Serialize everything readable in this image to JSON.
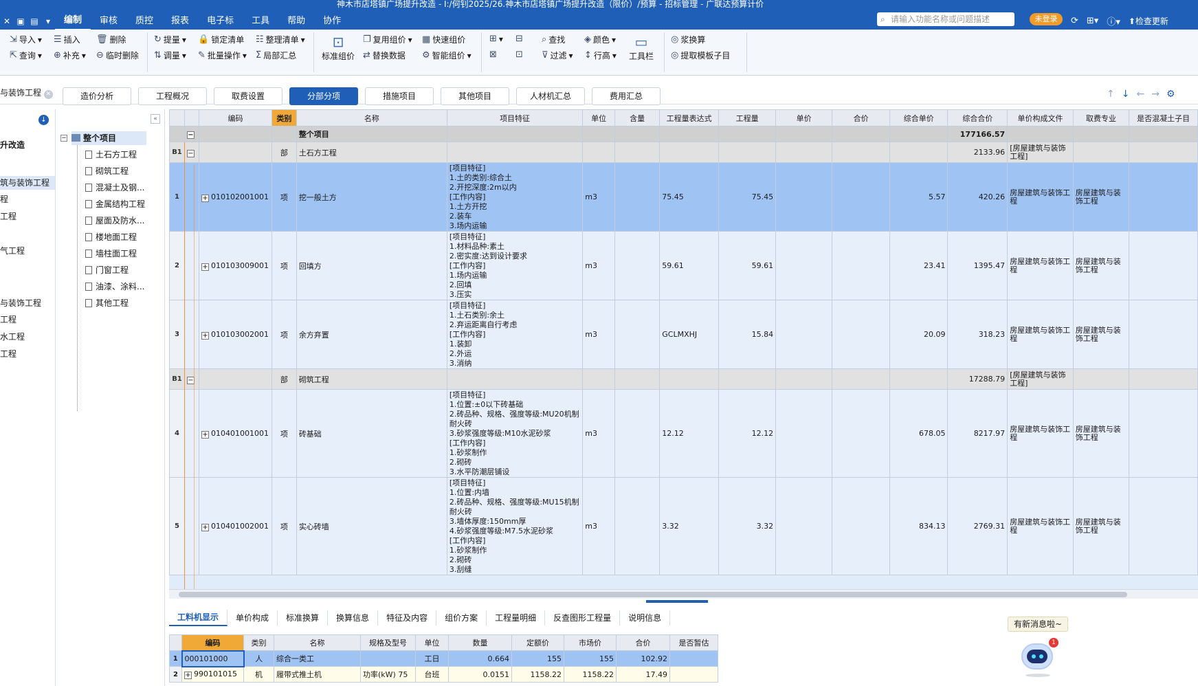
{
  "window": {
    "title": "神木市店塔镇广场提升改造 - I:/何钊2025/26.神木市店塔镇广场提升改造（限价）/预算 - 招标管理 - 广联达预算计价"
  },
  "menu": {
    "items": [
      "编制",
      "审核",
      "质控",
      "报表",
      "电子标",
      "工具",
      "帮助",
      "协作"
    ],
    "search_placeholder": "请输入功能名称或问题描述",
    "login_label": "未登录",
    "check_update": "检查更新"
  },
  "ribbon": {
    "import": "导入",
    "insert": "插入",
    "delete": "删除",
    "query": "查询",
    "supplement": "补充",
    "temp_delete": "临时删除",
    "extract_price": "提量",
    "lock_list": "锁定清单",
    "tidy_list": "整理清单",
    "adjust_qty": "调量",
    "batch_op": "批量操作",
    "partial_summary": "局部汇总",
    "std_price": "标准组价",
    "reuse_price": "复用组价",
    "quick_price": "快速组价",
    "replace_data": "替换数据",
    "smart_price": "智能组价",
    "find": "查找",
    "color": "颜色",
    "filter": "过滤",
    "row_height": "行高",
    "toolbar": "工具栏",
    "paste_calc": "浆换算",
    "extract_template": "提取模板子目"
  },
  "left_pane": {
    "title": "与装饰工程",
    "items": [
      "升改造",
      "筑与装饰工程",
      "程",
      "工程",
      "气工程",
      "与装饰工程",
      "工程",
      "水工程",
      "工程"
    ]
  },
  "tabs": [
    "造价分析",
    "工程概况",
    "取费设置",
    "分部分项",
    "措施项目",
    "其他项目",
    "人材机汇总",
    "费用汇总"
  ],
  "active_tab": "分部分项",
  "tree": {
    "root": "整个项目",
    "children": [
      "土石方工程",
      "砌筑工程",
      "混凝土及钢...",
      "金属结构工程",
      "屋面及防水...",
      "楼地面工程",
      "墙柱面工程",
      "门窗工程",
      "油漆、涂料...",
      "其他工程"
    ]
  },
  "grid": {
    "headers": [
      "编码",
      "类别",
      "名称",
      "项目特征",
      "单位",
      "含量",
      "工程量表达式",
      "工程量",
      "单价",
      "合价",
      "综合单价",
      "综合合价",
      "单价构成文件",
      "取费专业",
      "是否混凝土子目"
    ],
    "total": {
      "name": "整个项目",
      "total_price": "177166.57"
    },
    "rows": [
      {
        "type": "section",
        "rn": "B1",
        "kind": "部",
        "name": "土石方工程",
        "total_price": "2133.96",
        "file": "[房屋建筑与装饰工程]"
      },
      {
        "type": "item",
        "rn": "1",
        "code": "010102001001",
        "kind": "项",
        "name": "挖一般土方",
        "feature": "[项目特征]\n1.土的类别:综合土\n2.开挖深度:2m以内\n[工作内容]\n1.土方开挖\n2.装车\n3.场内运输",
        "unit": "m3",
        "expr": "75.45",
        "qty": "75.45",
        "unit_price": "5.57",
        "total_price": "420.26",
        "file": "房屋建筑与装饰工程",
        "fee": "房屋建筑与装饰工程",
        "selected": true
      },
      {
        "type": "item",
        "rn": "2",
        "code": "010103009001",
        "kind": "项",
        "name": "回填方",
        "feature": "[项目特征]\n1.材料品种:素土\n2.密实度:达到设计要求\n[工作内容]\n1.场内运输\n2.回填\n3.压实",
        "unit": "m3",
        "expr": "59.61",
        "qty": "59.61",
        "unit_price": "23.41",
        "total_price": "1395.47",
        "file": "房屋建筑与装饰工程",
        "fee": "房屋建筑与装饰工程"
      },
      {
        "type": "item",
        "rn": "3",
        "code": "010103002001",
        "kind": "项",
        "name": "余方弃置",
        "feature": "[项目特征]\n1.土石类别:余土\n2.弃运距离自行考虑\n[工作内容]\n1.装卸\n2.外运\n3.消纳",
        "unit": "m3",
        "expr": "GCLMXHJ",
        "qty": "15.84",
        "unit_price": "20.09",
        "total_price": "318.23",
        "file": "房屋建筑与装饰工程",
        "fee": "房屋建筑与装饰工程"
      },
      {
        "type": "section",
        "rn": "B1",
        "kind": "部",
        "name": "砌筑工程",
        "total_price": "17288.79",
        "file": "[房屋建筑与装饰工程]"
      },
      {
        "type": "item",
        "rn": "4",
        "code": "010401001001",
        "kind": "项",
        "name": "砖基础",
        "feature": "[项目特征]\n1.位置:±0以下砖基础\n2.砖品种、规格、强度等级:MU20机制耐火砖\n3.砂浆强度等级:M10水泥砂浆\n[工作内容]\n1.砂浆制作\n2.砌砖\n3.水平防潮层铺设",
        "unit": "m3",
        "expr": "12.12",
        "qty": "12.12",
        "unit_price": "678.05",
        "total_price": "8217.97",
        "file": "房屋建筑与装饰工程",
        "fee": "房屋建筑与装饰工程"
      },
      {
        "type": "item",
        "rn": "5",
        "code": "010401002001",
        "kind": "项",
        "name": "实心砖墙",
        "feature": "[项目特征]\n1.位置:内墙\n2.砖品种、规格、强度等级:MU15机制耐火砖\n3.墙体厚度:150mm厚\n4.砂浆强度等级:M7.5水泥砂浆\n[工作内容]\n1.砂浆制作\n2.砌砖\n3.刮缝",
        "unit": "m3",
        "expr": "3.32",
        "qty": "3.32",
        "unit_price": "834.13",
        "total_price": "2769.31",
        "file": "房屋建筑与装饰工程",
        "fee": "房屋建筑与装饰工程"
      }
    ]
  },
  "bottom_tabs": [
    "工料机显示",
    "单价构成",
    "标准换算",
    "换算信息",
    "特征及内容",
    "组价方案",
    "工程量明细",
    "反查图形工程量",
    "说明信息"
  ],
  "new_message": "有新消息啦~",
  "bot_badge": "1",
  "subgrid": {
    "headers": [
      "编码",
      "类别",
      "名称",
      "规格及型号",
      "单位",
      "数量",
      "定额价",
      "市场价",
      "合价",
      "是否暂估"
    ],
    "rows": [
      {
        "rn": "1",
        "code": "000101000",
        "kind": "人",
        "name": "综合一类工",
        "spec": "",
        "unit": "工日",
        "qty": "0.664",
        "quota": "155",
        "market": "155",
        "total": "102.92"
      },
      {
        "rn": "2",
        "code": "990101015",
        "kind": "机",
        "name": "履带式推土机",
        "spec": "功率(kW) 75",
        "unit": "台班",
        "qty": "0.0151",
        "quota": "1158.22",
        "market": "1158.22",
        "total": "17.49"
      }
    ]
  }
}
